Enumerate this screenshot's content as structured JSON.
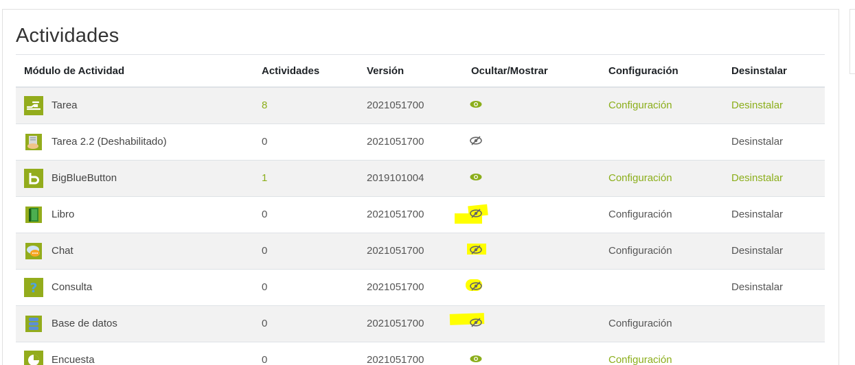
{
  "page": {
    "title": "Actividades"
  },
  "table": {
    "headers": {
      "module": "Módulo de Actividad",
      "activities": "Actividades",
      "version": "Versión",
      "visibility": "Ocultar/Mostrar",
      "settings": "Configuración",
      "uninstall": "Desinstalar"
    },
    "rows": [
      {
        "name": "Tarea",
        "count": "8",
        "version": "2021051700",
        "visible": true,
        "settings": "Configuración",
        "uninstall": "Desinstalar",
        "icon": "assign-icon"
      },
      {
        "name": "Tarea 2.2 (Deshabilitado)",
        "count": "0",
        "version": "2021051700",
        "visible": false,
        "settings": "",
        "uninstall": "Desinstalar",
        "icon": "assignment-icon"
      },
      {
        "name": "BigBlueButton",
        "count": "1",
        "version": "2019101004",
        "visible": true,
        "settings": "Configuración",
        "uninstall": "Desinstalar",
        "icon": "bigbluebutton-icon"
      },
      {
        "name": "Libro",
        "count": "0",
        "version": "2021051700",
        "visible": false,
        "settings": "Configuración",
        "uninstall": "Desinstalar",
        "icon": "book-icon"
      },
      {
        "name": "Chat",
        "count": "0",
        "version": "2021051700",
        "visible": false,
        "settings": "Configuración",
        "uninstall": "Desinstalar",
        "icon": "chat-icon"
      },
      {
        "name": "Consulta",
        "count": "0",
        "version": "2021051700",
        "visible": false,
        "settings": "",
        "uninstall": "Desinstalar",
        "icon": "choice-icon"
      },
      {
        "name": "Base de datos",
        "count": "0",
        "version": "2021051700",
        "visible": false,
        "settings": "Configuración",
        "uninstall": "",
        "icon": "database-icon"
      },
      {
        "name": "Encuesta",
        "count": "0",
        "version": "2021051700",
        "visible": true,
        "settings": "Configuración",
        "uninstall": "",
        "icon": "feedback-icon"
      }
    ]
  },
  "colors": {
    "link": "#8bae1a",
    "icon_green": "#93ac1c",
    "highlight": "#ffff00",
    "stripe": "#f2f2f2"
  }
}
